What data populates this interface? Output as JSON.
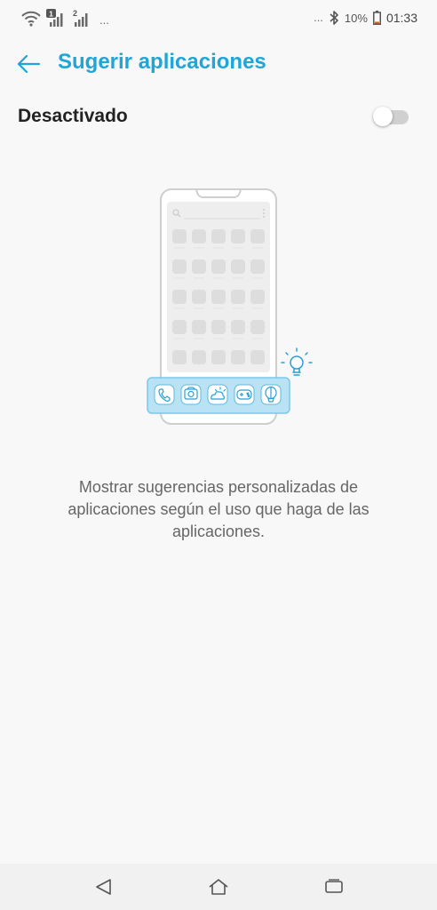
{
  "status_bar": {
    "sim1_badge": "1",
    "sim2_badge": "2",
    "left_overflow": "...",
    "right_overflow": "...",
    "battery_percent": "10%",
    "time": "01:33",
    "icons": [
      "wifi-icon",
      "signal-sim1-icon",
      "signal-sim2-icon",
      "bluetooth-icon",
      "battery-icon"
    ]
  },
  "app_bar": {
    "title": "Sugerir aplicaciones",
    "back_icon": "arrow-left-icon"
  },
  "toggle": {
    "label": "Desactivado",
    "state": "off"
  },
  "illustration": {
    "dock_icons": [
      "phone-icon",
      "camera-icon",
      "weather-icon",
      "gamepad-icon",
      "balloon-icon"
    ],
    "hint_icon": "lightbulb-icon"
  },
  "description": "Mostrar sugerencias personalizadas de aplicaciones según el uso que haga de las aplicaciones.",
  "nav_bar": {
    "icons": [
      "nav-back-icon",
      "nav-home-icon",
      "nav-recents-icon"
    ]
  },
  "colors": {
    "accent": "#1fa5d8",
    "background": "#f8f8f8",
    "illustration_blue": "#b9e3f4"
  }
}
